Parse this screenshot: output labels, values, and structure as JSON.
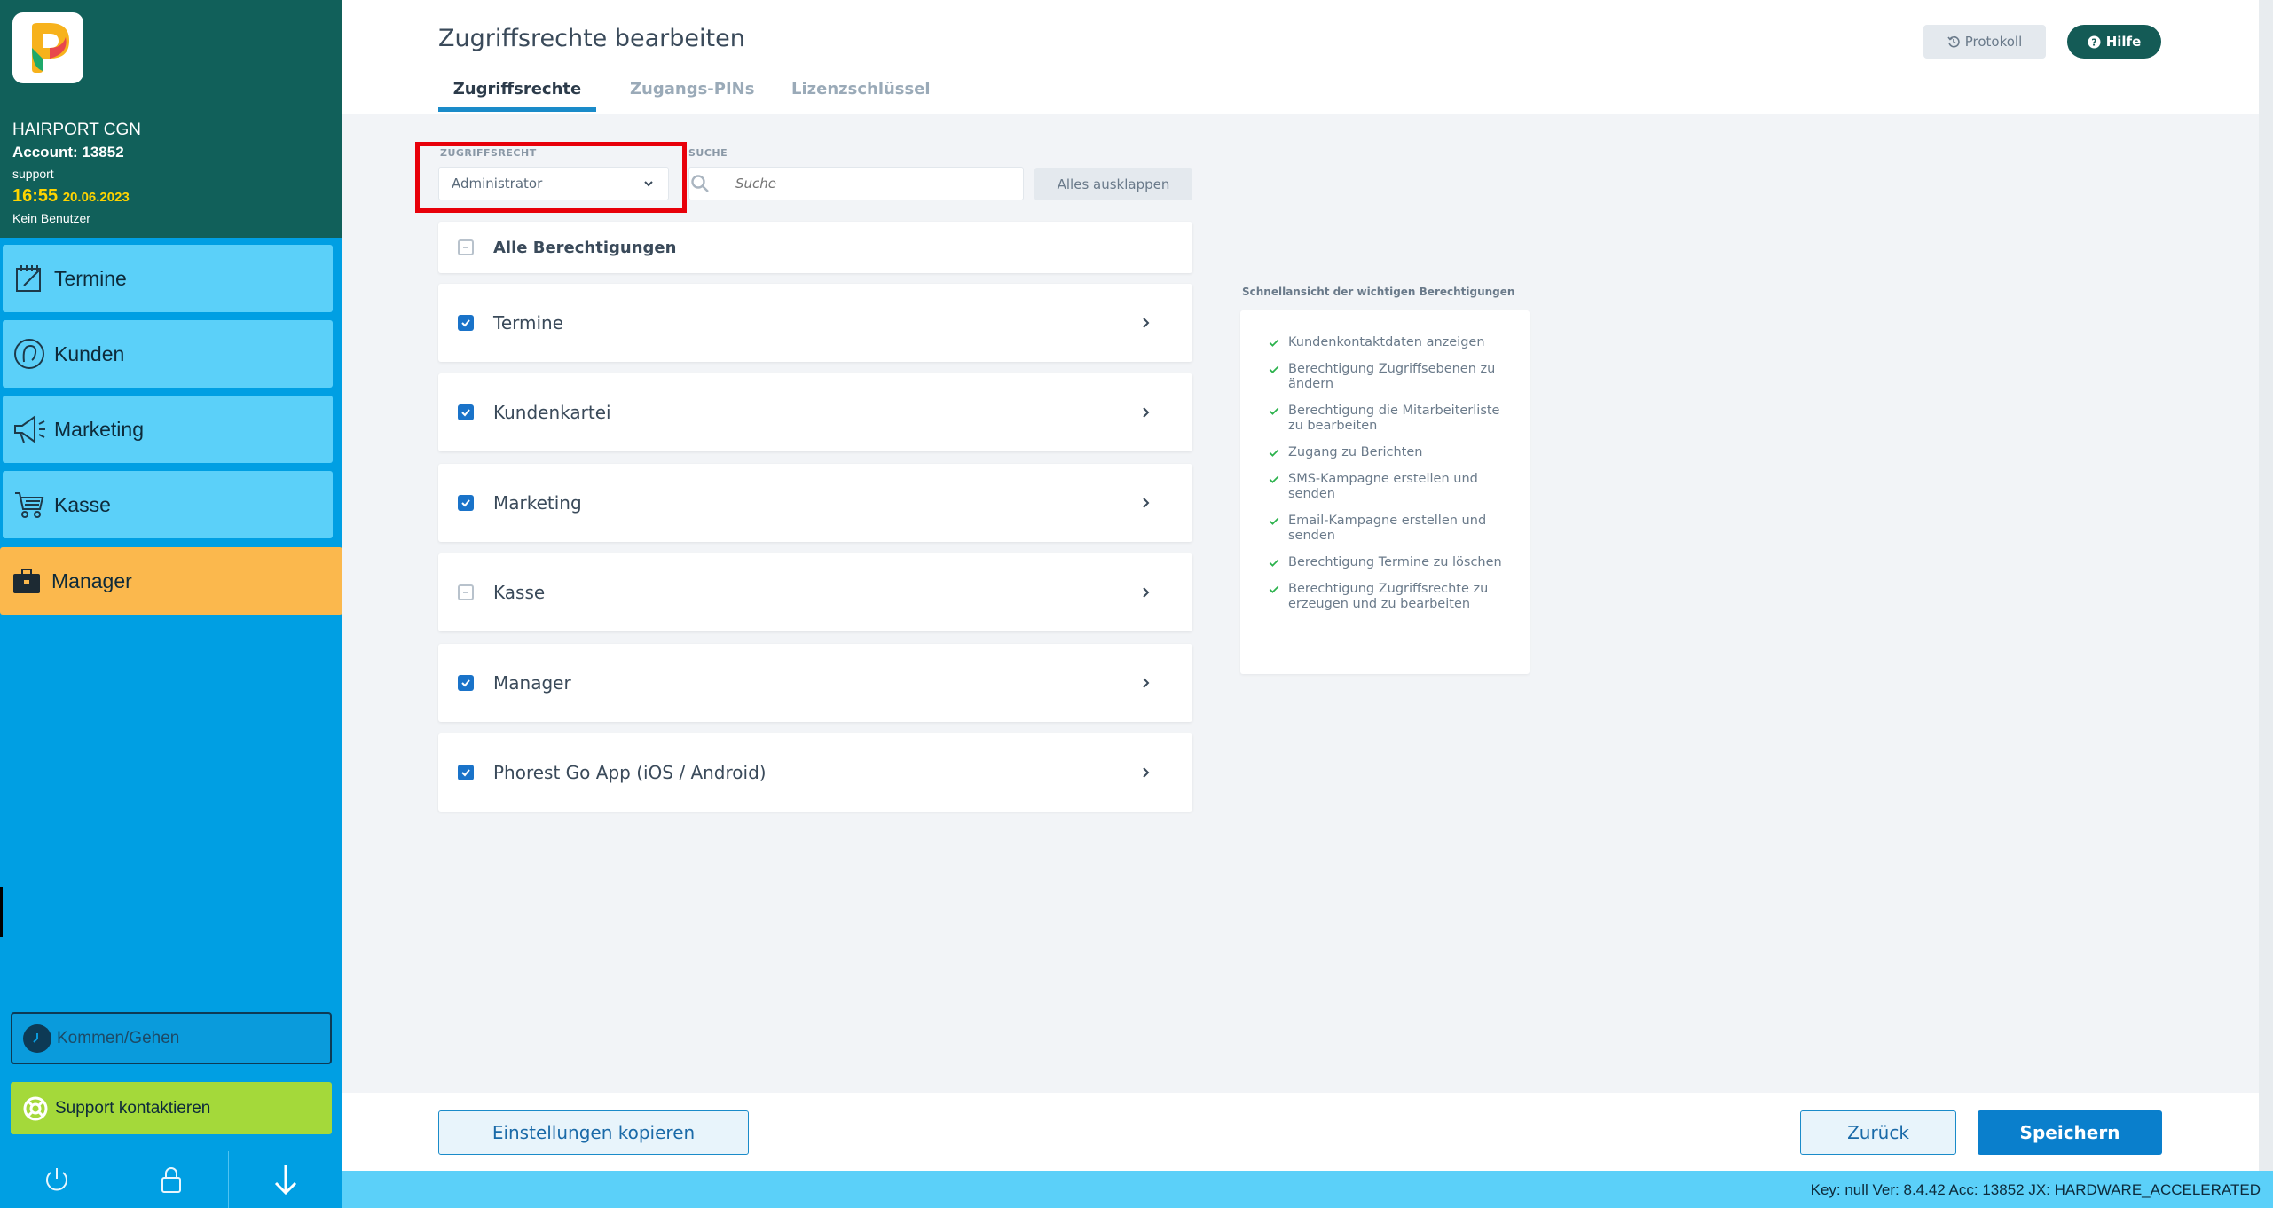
{
  "sidebar": {
    "company": "HAIRPORT CGN",
    "account": "Account: 13852",
    "user": "support",
    "time": "16:55",
    "date": "20.06.2023",
    "no_user": "Kein Benutzer",
    "nav": [
      {
        "label": "Termine",
        "icon": "calendar-icon"
      },
      {
        "label": "Kunden",
        "icon": "customer-icon"
      },
      {
        "label": "Marketing",
        "icon": "megaphone-icon"
      },
      {
        "label": "Kasse",
        "icon": "cart-icon"
      },
      {
        "label": "Manager",
        "icon": "briefcase-icon",
        "active": true
      }
    ],
    "kommen_gehen": "Kommen/Gehen",
    "support": "Support kontaktieren"
  },
  "header": {
    "title": "Zugriffsrechte bearbeiten",
    "tabs": [
      "Zugriffsrechte",
      "Zugangs-PINs",
      "Lizenzschlüssel"
    ],
    "active_tab": "Zugriffsrechte",
    "protokoll": "Protokoll",
    "hilfe": "Hilfe"
  },
  "filter": {
    "role_label": "ZUGRIFFSRECHT",
    "role_value": "Administrator",
    "search_label": "SUCHE",
    "search_placeholder": "Suche",
    "expand_all": "Alles ausklappen"
  },
  "permissions": {
    "all_label": "Alle Berechtigungen",
    "items": [
      {
        "label": "Termine",
        "state": "checked"
      },
      {
        "label": "Kundenkartei",
        "state": "checked"
      },
      {
        "label": "Marketing",
        "state": "checked"
      },
      {
        "label": "Kasse",
        "state": "partial"
      },
      {
        "label": "Manager",
        "state": "checked"
      },
      {
        "label": "Phorest Go App (iOS / Android)",
        "state": "checked"
      }
    ]
  },
  "quickview": {
    "title": "Schnellansicht der wichtigen Berechtigungen",
    "items": [
      "Kundenkontaktdaten anzeigen",
      "Berechtigung Zugriffsebenen zu ändern",
      "Berechtigung die Mitarbeiterliste zu bearbeiten",
      "Zugang zu Berichten",
      "SMS-Kampagne erstellen und senden",
      "Email-Kampagne erstellen und senden",
      "Berechtigung Termine zu löschen",
      "Berechtigung Zugriffsrechte zu erzeugen und zu bearbeiten"
    ]
  },
  "footer": {
    "copy_settings": "Einstellungen kopieren",
    "back": "Zurück",
    "save": "Speichern"
  },
  "status": "Key: null Ver: 8.4.42 Acc: 13852  JX: HARDWARE_ACCELERATED",
  "colors": {
    "sidebar_header": "#11605a",
    "sidebar_bg": "#009fe3",
    "nav_item": "#5bd0f9",
    "nav_active": "#fbb84d",
    "primary": "#0a7fcc",
    "highlight": "#e8000a",
    "check_green": "#2bb24c"
  }
}
